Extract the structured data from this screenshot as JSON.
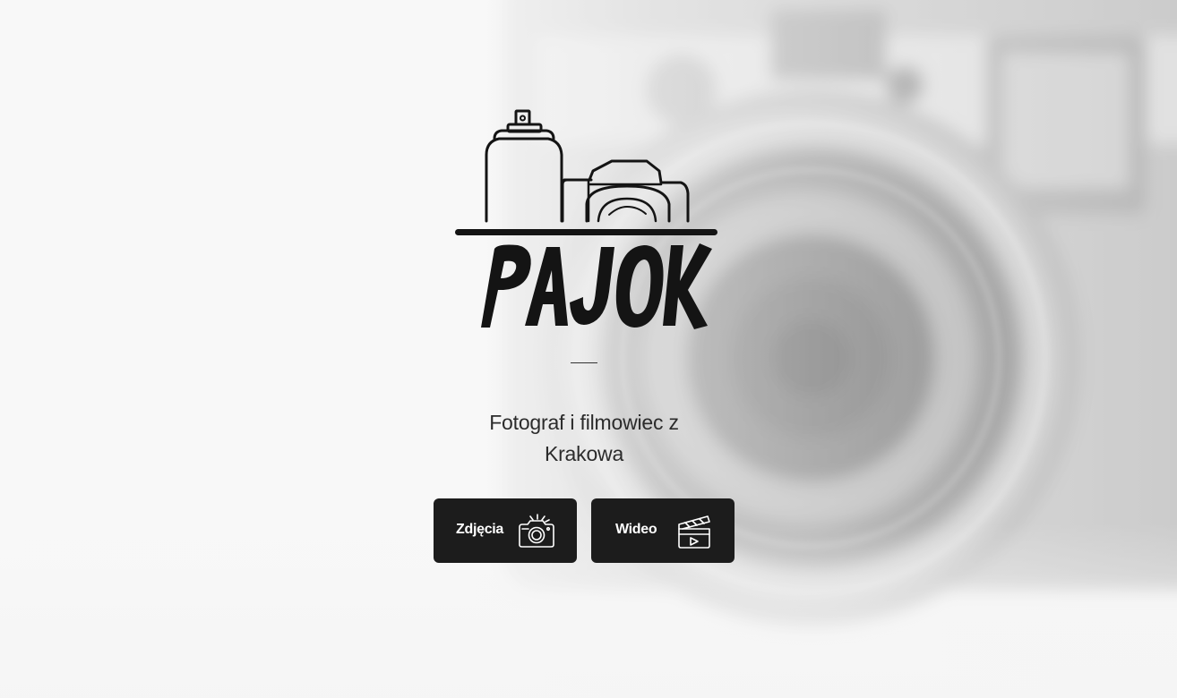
{
  "brand": {
    "name": "PAJOK"
  },
  "hero": {
    "tagline_line1": "Fotograf i filmowiec z",
    "tagline_line2": "Krakowa"
  },
  "buttons": {
    "photos_label": "Zdjęcia",
    "photos_icon": "camera-icon",
    "video_label": "Wideo",
    "video_icon": "clapperboard-icon"
  },
  "colors": {
    "background": "#f4f4f4",
    "button_bg": "#1c1c1c",
    "button_text": "#ffffff",
    "text": "#2b2b2b",
    "logo": "#141414"
  }
}
